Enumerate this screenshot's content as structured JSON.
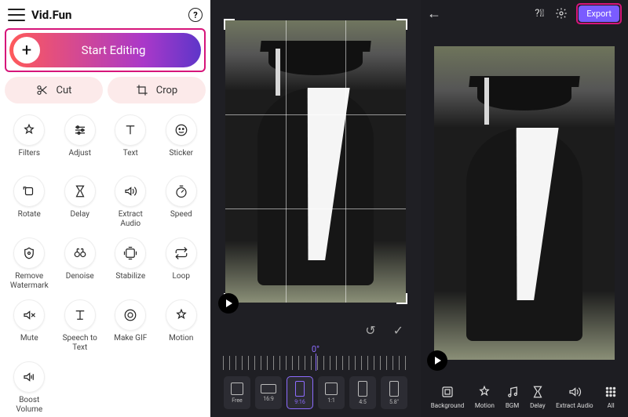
{
  "left": {
    "appTitle": "Vid.Fun",
    "startLabel": "Start Editing",
    "quick": {
      "cut": "Cut",
      "crop": "Crop"
    },
    "tools": [
      {
        "id": "filters",
        "label": "Filters"
      },
      {
        "id": "adjust",
        "label": "Adjust"
      },
      {
        "id": "text",
        "label": "Text"
      },
      {
        "id": "sticker",
        "label": "Sticker"
      },
      {
        "id": "rotate",
        "label": "Rotate"
      },
      {
        "id": "delay",
        "label": "Delay"
      },
      {
        "id": "extract-audio",
        "label": "Extract\nAudio"
      },
      {
        "id": "speed",
        "label": "Speed"
      },
      {
        "id": "remove-watermark",
        "label": "Remove\nWatermark"
      },
      {
        "id": "denoise",
        "label": "Denoise"
      },
      {
        "id": "stabilize",
        "label": "Stabilize"
      },
      {
        "id": "loop",
        "label": "Loop"
      },
      {
        "id": "mute",
        "label": "Mute"
      },
      {
        "id": "speech-to-text",
        "label": "Speech to\nText"
      },
      {
        "id": "make-gif",
        "label": "Make GIF"
      },
      {
        "id": "motion",
        "label": "Motion"
      },
      {
        "id": "boost-volume",
        "label": "Boost\nVolume"
      }
    ]
  },
  "mid": {
    "angle": "0°",
    "aspects": [
      {
        "id": "free",
        "label": "Free",
        "active": false
      },
      {
        "id": "16-9",
        "label": "16:9",
        "active": false
      },
      {
        "id": "tiktok",
        "label": "9:16",
        "active": true
      },
      {
        "id": "1-1",
        "label": "1:1",
        "active": false
      },
      {
        "id": "ig",
        "label": "4:5",
        "active": false
      },
      {
        "id": "apple",
        "label": "5.8\"",
        "active": false
      }
    ]
  },
  "right": {
    "exportLabel": "Export",
    "tools": [
      {
        "id": "background",
        "label": "Background"
      },
      {
        "id": "motion",
        "label": "Motion"
      },
      {
        "id": "bgm",
        "label": "BGM"
      },
      {
        "id": "delay",
        "label": "Delay"
      },
      {
        "id": "extract-audio",
        "label": "Extract Audio"
      },
      {
        "id": "all",
        "label": "All"
      }
    ]
  }
}
